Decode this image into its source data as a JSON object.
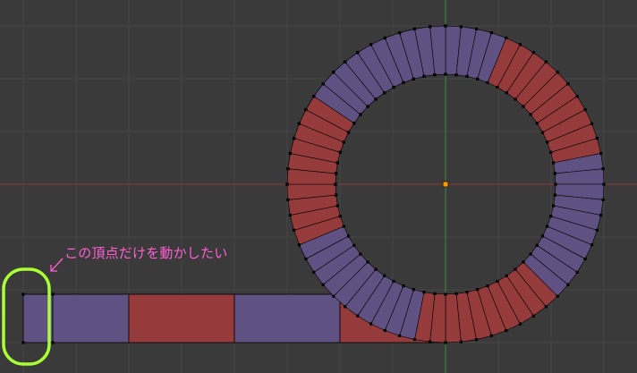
{
  "annotation": {
    "text": "この頂点だけを動かしたい",
    "color": "#ff5fd2",
    "highlight_color": "#aaff33"
  },
  "viewport": {
    "background": "#3a3a3a",
    "grid_color": "#454545",
    "x_axis_color": "#8b3a3a",
    "y_axis_color": "#3f8a3f",
    "origin_color": "#ff9900"
  },
  "mesh": {
    "colors": {
      "purple": "#5f5282",
      "red": "#963b3b",
      "edge": "#000000",
      "vertex": "#000000"
    },
    "straight_segments": [
      "purple",
      "purple",
      "red",
      "purple",
      "red"
    ],
    "arc_blocks": [
      "red",
      "purple",
      "red",
      "purple",
      "red",
      "purple",
      "red",
      "purple"
    ],
    "arc_faces_per_block": 10
  }
}
